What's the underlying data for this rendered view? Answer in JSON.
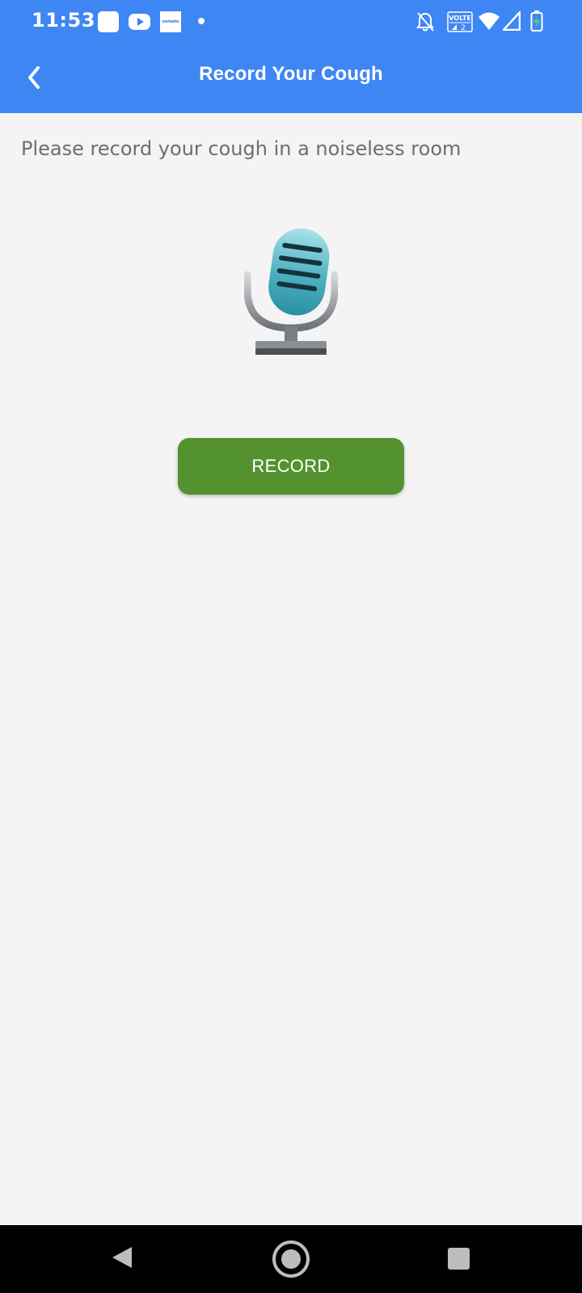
{
  "status_bar": {
    "time": "11:53",
    "notification_icons": [
      "app-square-icon",
      "youtube-icon",
      "zomato-icon",
      "dot-icon"
    ],
    "zomato_label": "zomato",
    "volte_label": "VOLTE",
    "sim_label": "2",
    "system_icons": [
      "bell-off-icon",
      "volte-icon",
      "wifi-icon",
      "signal-icon",
      "battery-charging-icon"
    ]
  },
  "app_bar": {
    "title": "Record Your Cough"
  },
  "main": {
    "instruction": "Please record your cough in a noiseless room",
    "record_button_label": "RECORD"
  },
  "colors": {
    "app_bar": "#3f86f5",
    "record_button": "#54912f",
    "background": "#f4f4f4",
    "instruction_text": "#6e6e6e",
    "nav_bar": "#000000"
  }
}
